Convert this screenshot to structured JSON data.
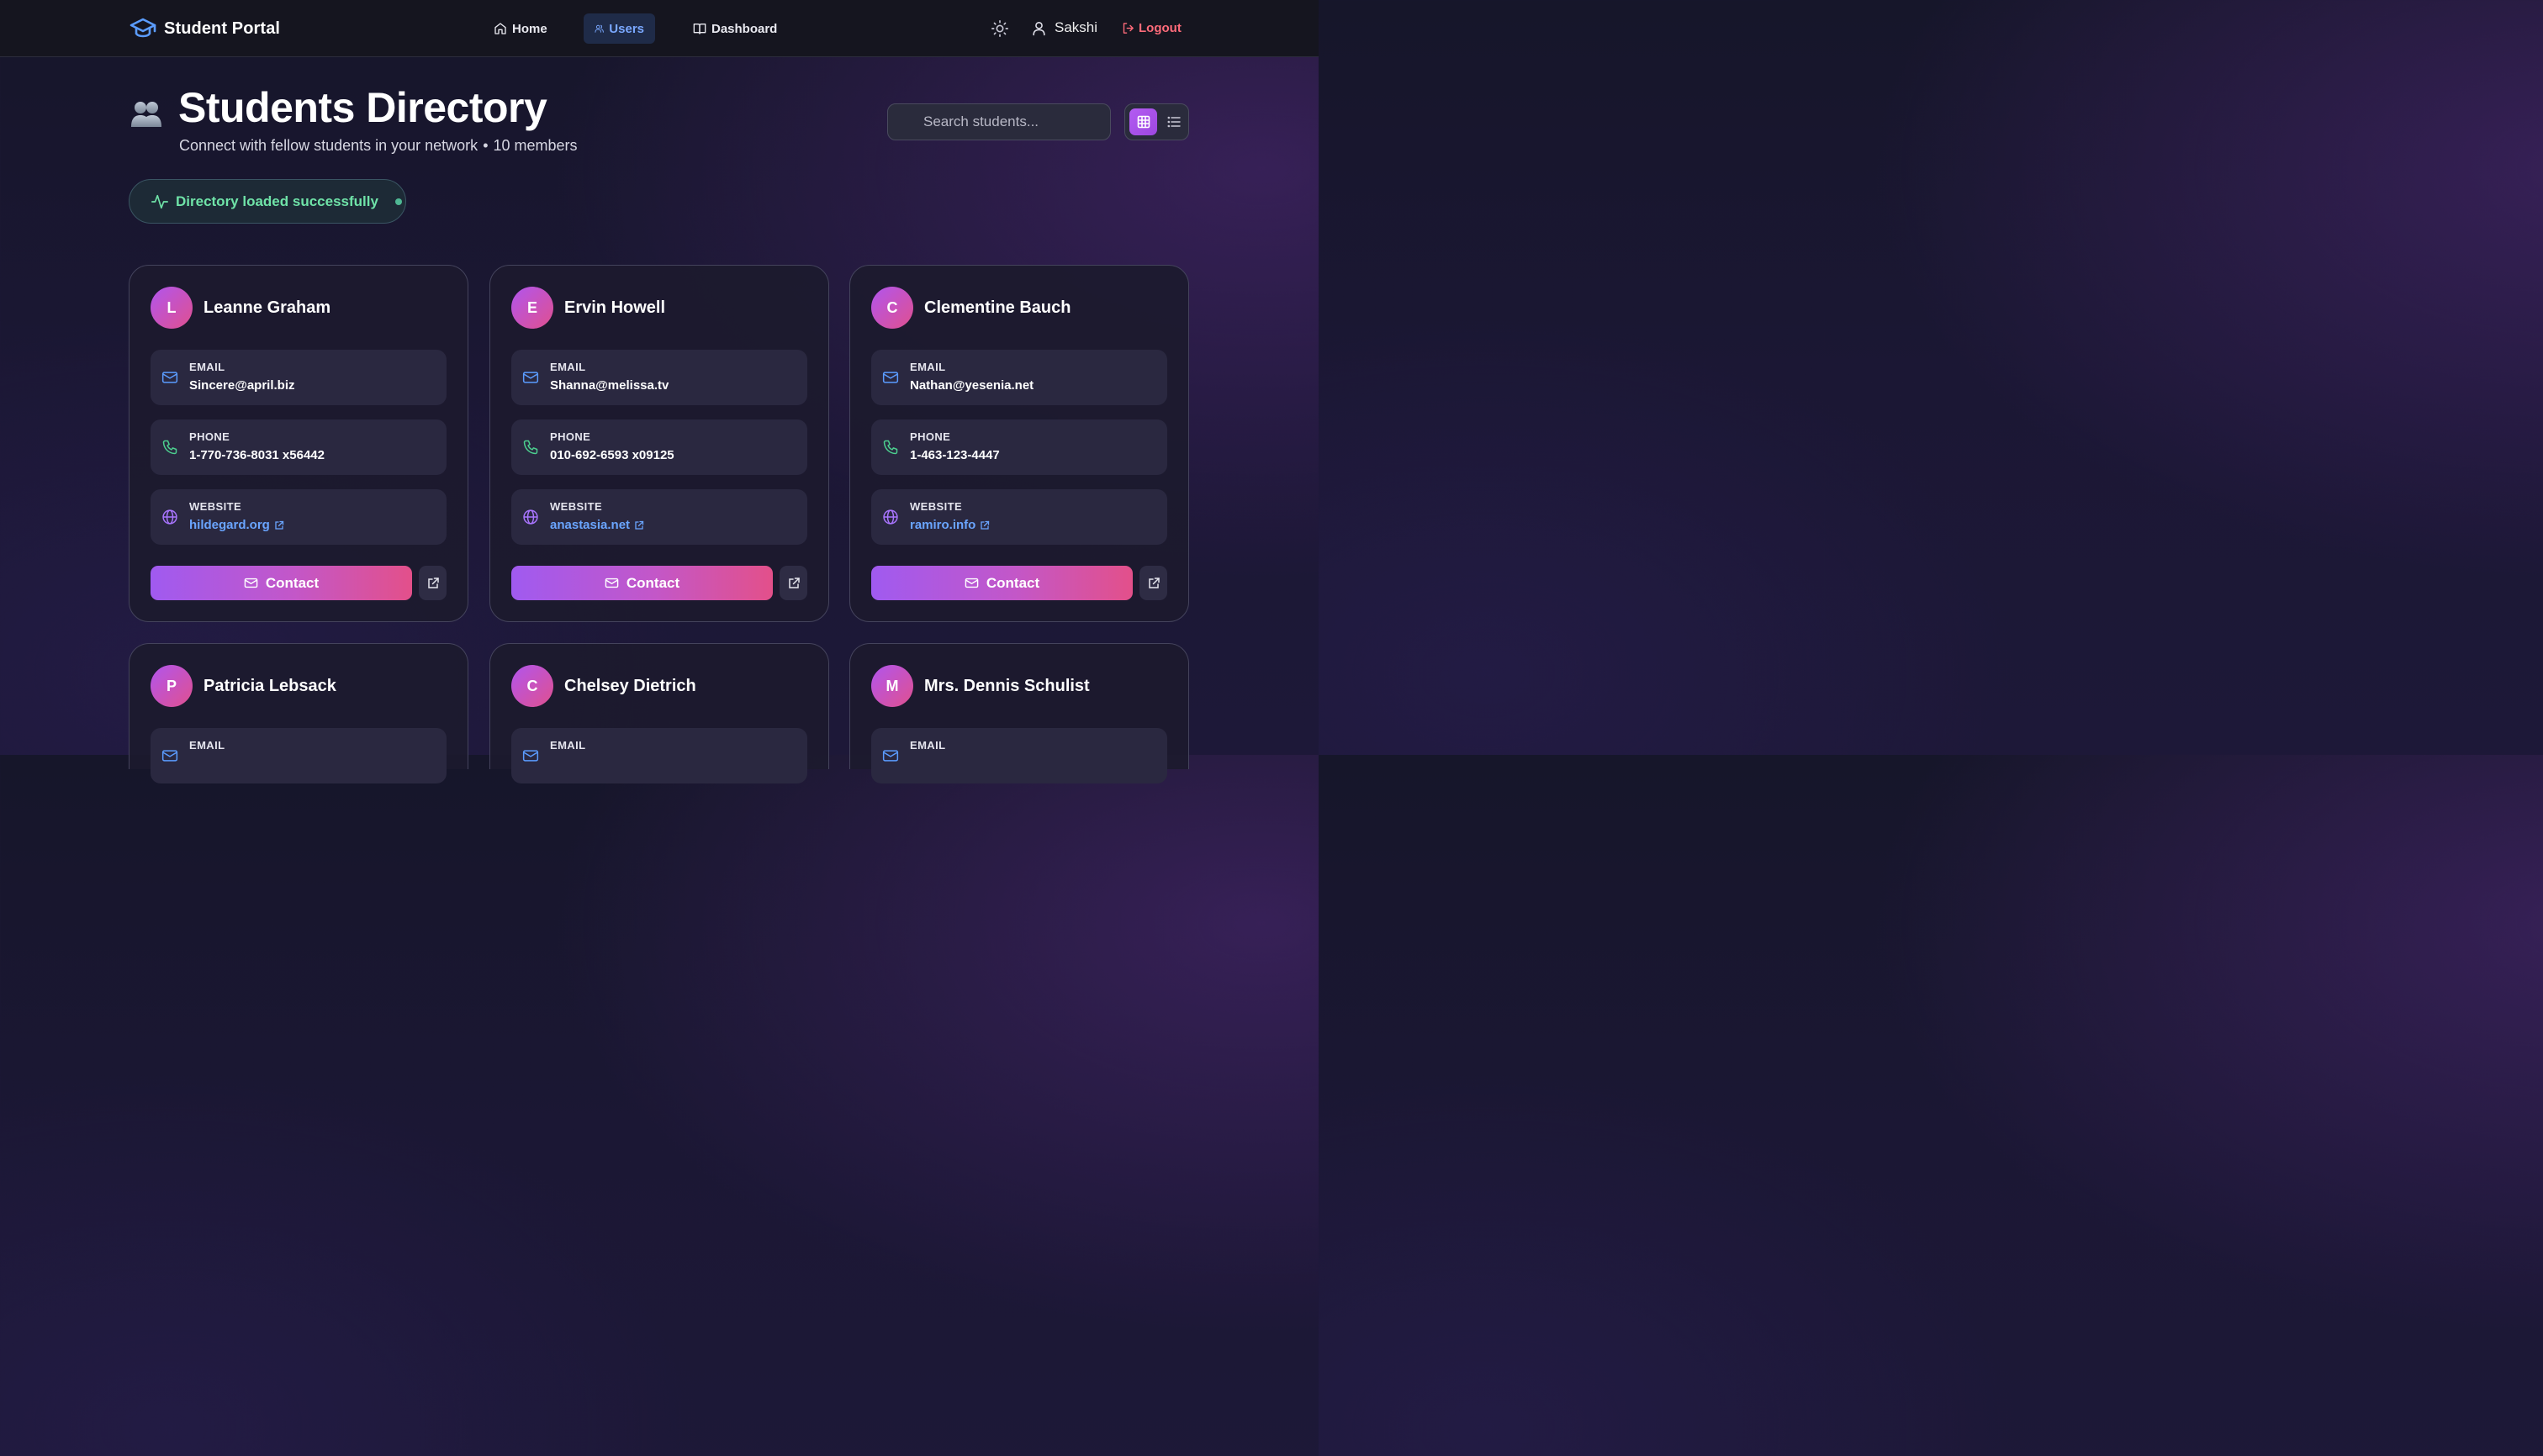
{
  "nav": {
    "brand": "Student Portal",
    "links": [
      {
        "label": "Home",
        "active": false
      },
      {
        "label": "Users",
        "active": true
      },
      {
        "label": "Dashboard",
        "active": false
      }
    ],
    "user": "Sakshi",
    "logout": "Logout"
  },
  "header": {
    "title": "Students Directory",
    "subtitle": "Connect with fellow students in your network",
    "separator": "•",
    "member_count": "10 members"
  },
  "search": {
    "placeholder": "Search students..."
  },
  "status": {
    "text": "Directory loaded successfully"
  },
  "labels": {
    "email": "EMAIL",
    "phone": "PHONE",
    "website": "WEBSITE",
    "contact": "Contact"
  },
  "students": [
    {
      "initial": "L",
      "name": "Leanne Graham",
      "email": "Sincere@april.biz",
      "phone": "1-770-736-8031 x56442",
      "website": "hildegard.org"
    },
    {
      "initial": "E",
      "name": "Ervin Howell",
      "email": "Shanna@melissa.tv",
      "phone": "010-692-6593 x09125",
      "website": "anastasia.net"
    },
    {
      "initial": "C",
      "name": "Clementine Bauch",
      "email": "Nathan@yesenia.net",
      "phone": "1-463-123-4447",
      "website": "ramiro.info"
    },
    {
      "initial": "P",
      "name": "Patricia Lebsack"
    },
    {
      "initial": "C",
      "name": "Chelsey Dietrich"
    },
    {
      "initial": "M",
      "name": "Mrs. Dennis Schulist"
    }
  ],
  "colors": {
    "accent": "#a05af0",
    "accent_end": "#e3508a",
    "link": "#6aa5ff",
    "success": "#6fe3a8",
    "logout": "#ff6b7a"
  }
}
